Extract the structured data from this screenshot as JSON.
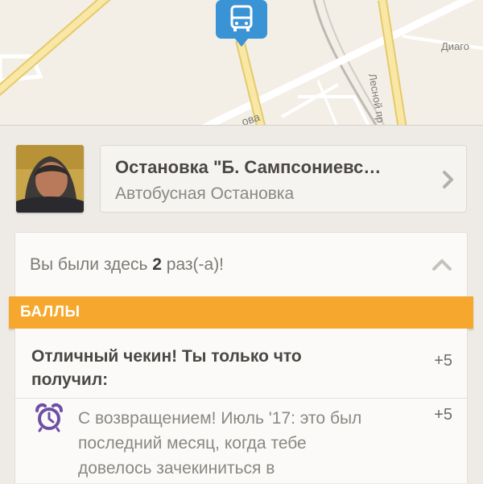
{
  "map": {
    "labels": {
      "street_right": "Диаго",
      "street_vertical": "Лесной пр",
      "street_partial": "ова"
    },
    "pin": {
      "icon": "bus-icon",
      "color": "#3a93d5"
    }
  },
  "venue": {
    "name": "Остановка \"Б. Сампсониевс…",
    "category": "Автобусная Остановка",
    "avatar_icon": "user-avatar"
  },
  "visits": {
    "prefix": "Вы были здесь ",
    "count": "2",
    "suffix": " раз(-а)!"
  },
  "points": {
    "header": "БАЛЛЫ",
    "header_color": "#f6a82e",
    "title": "Отличный чекин! Ты только что получил:",
    "total": "+5",
    "items": [
      {
        "icon": "alarm-clock-icon",
        "text": "С возвращением! Июль '17: это был последний месяц, когда тебе довелось зачекиниться в",
        "value": "+5"
      }
    ]
  }
}
